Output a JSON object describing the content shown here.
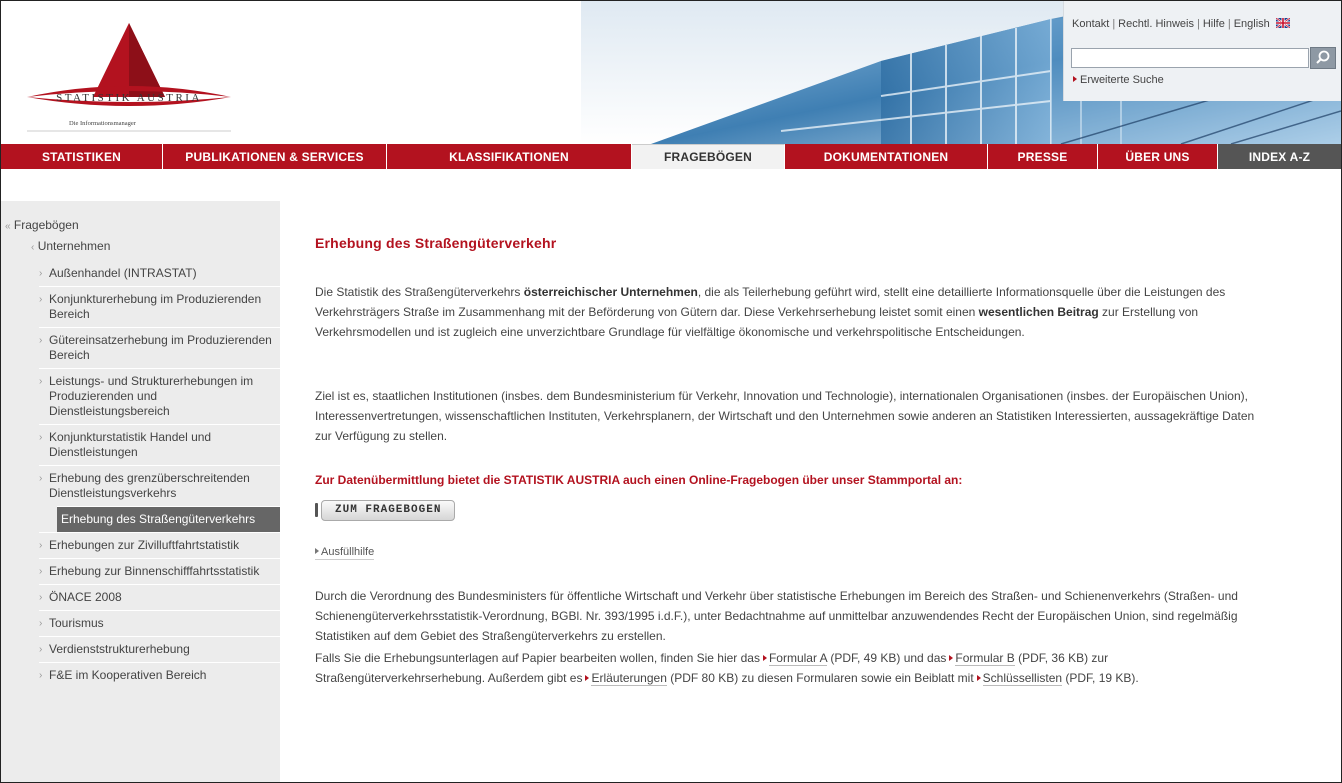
{
  "brand": {
    "name": "STATISTIK AUSTRIA",
    "tagline": "Die Informationsmanager",
    "colors": {
      "primary": "#b3121f",
      "nav_dark": "#555555",
      "sidebar_bg": "#ececec",
      "selected_bg": "#666666"
    }
  },
  "utility": {
    "links": [
      "Kontakt",
      "Rechtl. Hinweis",
      "Hilfe",
      "English"
    ],
    "search_placeholder": "",
    "advanced_search": "Erweiterte Suche",
    "search_icon": "magnifier-icon",
    "flag_icon": "uk-flag-icon"
  },
  "nav": {
    "items": [
      {
        "label": "STATISTIKEN"
      },
      {
        "label": "PUBLIKATIONEN & SERVICES"
      },
      {
        "label": "KLASSIFIKATIONEN"
      },
      {
        "label": "FRAGEBÖGEN"
      },
      {
        "label": "DOKUMENTATIONEN"
      },
      {
        "label": "PRESSE"
      },
      {
        "label": "ÜBER UNS"
      },
      {
        "label": "INDEX A-Z"
      }
    ],
    "active": "FRAGEBÖGEN"
  },
  "sidebar": {
    "top": "Fragebögen",
    "sub": "Unternehmen",
    "items": [
      {
        "label": "Außenhandel (INTRASTAT)"
      },
      {
        "label": "Konjunkturerhebung im Produzierenden Bereich"
      },
      {
        "label": "Gütereinsatzerhebung im Produzierenden Bereich"
      },
      {
        "label": "Leistungs- und Strukturerhebungen im Produzierenden und Dienstleistungsbereich"
      },
      {
        "label": "Konjunkturstatistik Handel und Dienstleistungen"
      },
      {
        "label": "Erhebung des grenzüberschreitenden Dienstleistungsverkehrs"
      },
      {
        "label": "Erhebung des Straßengüterverkehrs"
      },
      {
        "label": "Erhebungen zur Zivilluftfahrtstatistik"
      },
      {
        "label": "Erhebung zur Binnenschifffahrtsstatistik"
      },
      {
        "label": "ÖNACE 2008"
      },
      {
        "label": "Tourismus"
      },
      {
        "label": "Verdienststrukturerhebung"
      },
      {
        "label": "F&E im Kooperativen Bereich"
      }
    ],
    "selected_index": 6
  },
  "content": {
    "title": "Erhebung des Straßengüterverkehr",
    "p1": {
      "t1": "Die Statistik des Straßengüterverkehrs ",
      "b1": "österreichischer Unternehmen",
      "t2": ", die als Teilerhebung geführt wird, stellt eine detaillierte Informationsquelle über die Leistungen des  Verkehrsträgers Straße im Zusammenhang mit der Beförderung von Gütern dar. Diese Verkehrserhebung leistet somit einen ",
      "b2": "wesentlichen Beitrag",
      "t3": " zur Erstellung von Verkehrsmodellen und ist zugleich eine unverzichtbare Grundlage für vielfältige ökonomische und verkehrspolitische Entscheidungen."
    },
    "p2": "Ziel ist es, staatlichen Institutionen (insbes. dem Bundesministerium für Verkehr, Innovation und Technologie), internationalen Organisationen (insbes. der Europäischen Union), Interessenvertretungen, wissenschaftlichen Instituten, Verkehrsplanern, der Wirtschaft und den Unternehmen sowie anderen an Statistiken Interessierten, aussagekräftige Daten zur Verfügung zu stellen.",
    "highlight": "Zur Datenübermittlung bietet die STATISTIK AUSTRIA auch einen Online-Fragebogen über unser Stammportal an:",
    "button": "ZUM FRAGEBOGEN",
    "help_link": "Ausfüllhilfe",
    "p3": "Durch die Verordnung des Bundesministers für  öffentliche Wirtschaft und Verkehr über statistische Erhebungen im Bereich des Straßen- und Schienenverkehrs (Straßen- und Schienengüterverkehrsstatistik-Verordnung, BGBl. Nr. 393/1995 i.d.F.), unter Bedachtnahme auf unmittelbar anzuwendendes Recht der Europäischen Union, sind regelmäßig Statistiken auf dem Gebiet des Straßengüterverkehrs zu erstellen.",
    "p4": {
      "t1": "Falls Sie die Erhebungsunterlagen auf Papier bearbeiten wollen, finden Sie hier das",
      "link1": "Formular A",
      "t2": " (PDF, 49 KB) und das",
      "link2": "Formular B",
      "t3": " (PDF, 36 KB) zur Straßengüterverkehrserhebung. Außerdem gibt es",
      "link3": "Erläuterungen",
      "t4": " (PDF 80 KB) zu diesen Formularen sowie ein Beiblatt mit",
      "link4": "Schlüssellisten",
      "t5": " (PDF, 19 KB)."
    }
  }
}
